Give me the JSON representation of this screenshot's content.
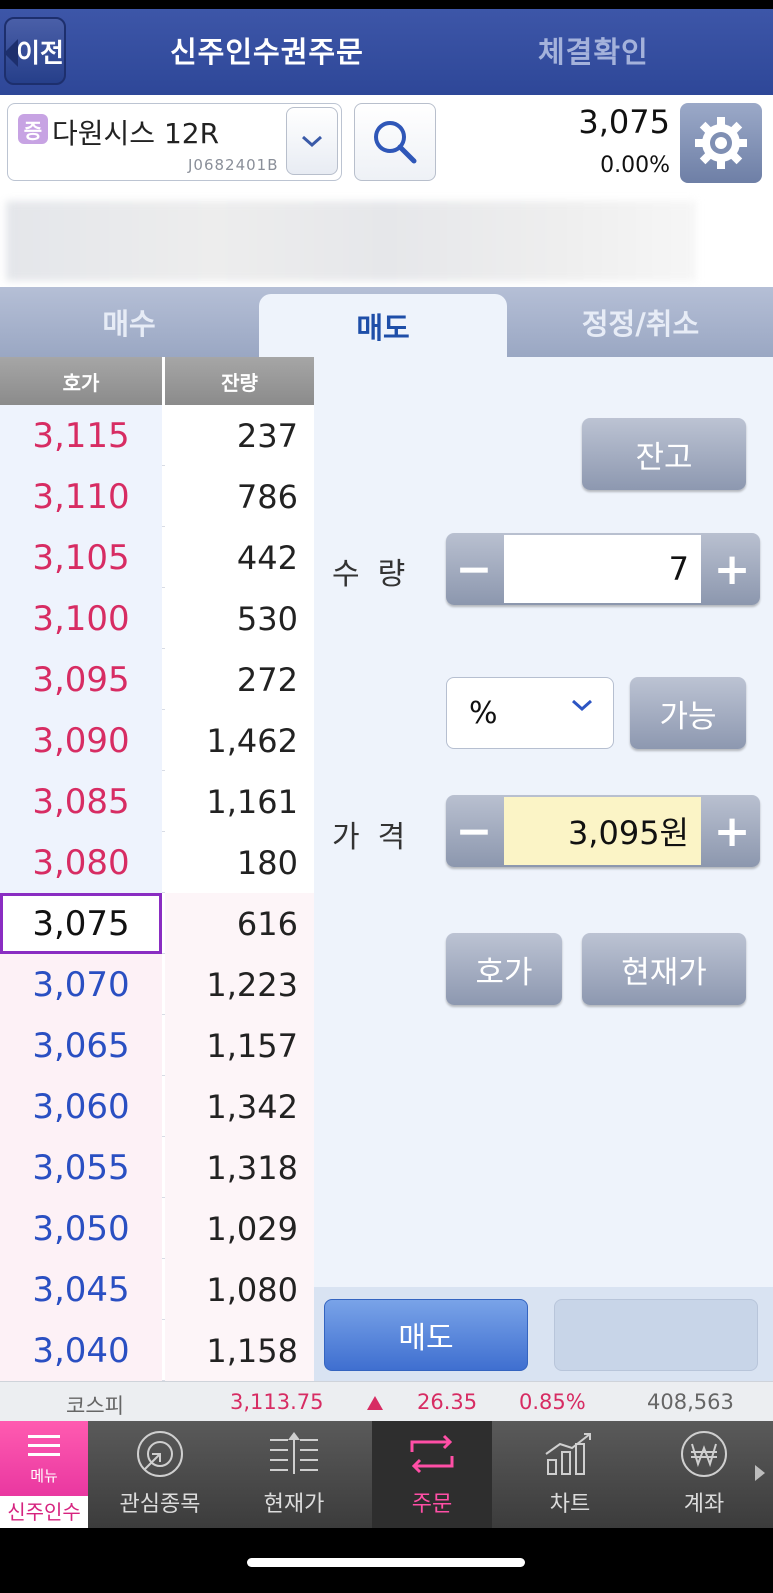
{
  "header": {
    "back_label": "이전",
    "tab_active": "신주인수권주문",
    "tab_inactive": "체결확인"
  },
  "stock": {
    "badge": "증",
    "name": "다원시스 12R",
    "code": "J0682401B",
    "price": "3,075",
    "change_pct": "0.00%"
  },
  "order_tabs": [
    "매수",
    "매도",
    "정정/취소"
  ],
  "orderbook": {
    "header_price": "호가",
    "header_qty": "잔량",
    "asks": [
      {
        "price": "3,115",
        "qty": "237"
      },
      {
        "price": "3,110",
        "qty": "786"
      },
      {
        "price": "3,105",
        "qty": "442"
      },
      {
        "price": "3,100",
        "qty": "530"
      },
      {
        "price": "3,095",
        "qty": "272"
      },
      {
        "price": "3,090",
        "qty": "1,462"
      },
      {
        "price": "3,085",
        "qty": "1,161"
      },
      {
        "price": "3,080",
        "qty": "180"
      }
    ],
    "current": {
      "price": "3,075",
      "qty": "616"
    },
    "bids": [
      {
        "price": "3,070",
        "qty": "1,223"
      },
      {
        "price": "3,065",
        "qty": "1,157"
      },
      {
        "price": "3,060",
        "qty": "1,342"
      },
      {
        "price": "3,055",
        "qty": "1,318"
      },
      {
        "price": "3,050",
        "qty": "1,029"
      },
      {
        "price": "3,045",
        "qty": "1,080"
      },
      {
        "price": "3,040",
        "qty": "1,158"
      }
    ]
  },
  "panel": {
    "balance_btn": "잔고",
    "qty_label": "수량",
    "qty_value": "7",
    "minus": "−",
    "plus": "+",
    "pct_select": "%",
    "possible_btn": "가능",
    "price_label": "가격",
    "price_value": "3,095원",
    "hoga_btn": "호가",
    "current_price_btn": "현재가",
    "sell_btn": "매도"
  },
  "ticker": {
    "name": "코스피",
    "value": "3,113.75",
    "change": "26.35",
    "change_pct": "0.85%",
    "volume": "408,563",
    "up_color": "#d72c63"
  },
  "tabbar": {
    "menu": "메뉴",
    "menu_sub": "신주인수권",
    "items": [
      "관심종목",
      "현재가",
      "주문",
      "차트",
      "계좌"
    ]
  }
}
